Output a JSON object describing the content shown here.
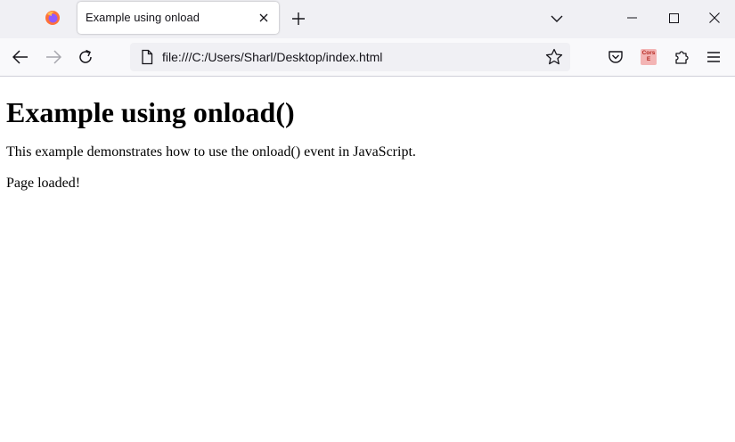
{
  "browser": {
    "tab": {
      "title": "Example using onload"
    },
    "address_bar": {
      "url": "file:///C:/Users/Sharl/Desktop/index.html"
    },
    "extensions": {
      "cors_badge": "Cors E"
    },
    "colors": {
      "tabbar_bg": "#f0f0f4",
      "toolbar_bg": "#f9f9fb",
      "cors_badge_bg": "#f3b4b4",
      "cors_badge_text": "#b3261e"
    }
  },
  "page": {
    "heading": "Example using onload()",
    "description": "This example demonstrates how to use the onload() event in JavaScript.",
    "status": "Page loaded!"
  }
}
